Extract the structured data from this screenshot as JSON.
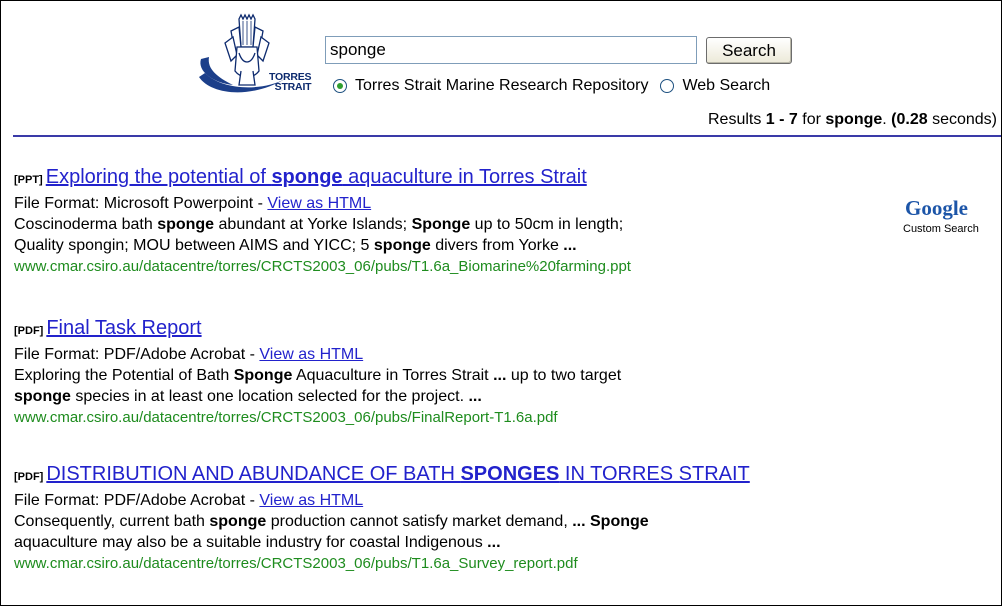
{
  "search": {
    "query": "sponge",
    "button_label": "Search",
    "options": [
      {
        "label": "Torres Strait Marine Research Repository",
        "selected": true
      },
      {
        "label": "Web Search",
        "selected": false
      }
    ]
  },
  "logo": {
    "line1": "TORRES",
    "line2": "STRAIT"
  },
  "summary": {
    "prefix": "Results ",
    "range": "1 - 7",
    "for_text": " for ",
    "query": "sponge",
    "dot": ". ",
    "time": "(0.28",
    "seconds": " seconds)"
  },
  "branding": {
    "google": "Google",
    "custom_search": "Custom Search"
  },
  "results": [
    {
      "tag": "[PPT]",
      "title_parts": [
        "Exploring the potential of ",
        "sponge",
        " aquaculture in Torres Strait"
      ],
      "format_label": "File Format: Microsoft Powerpoint - ",
      "view_html": "View as HTML",
      "snippet1": [
        "Coscinoderma bath ",
        "sponge",
        " abundant at Yorke Islands; ",
        "Sponge",
        " up to 50cm in length;"
      ],
      "snippet2": [
        "Quality spongin; MOU between AIMS and YICC; 5 ",
        "sponge",
        " divers from Yorke ",
        "..."
      ],
      "url": "www.cmar.csiro.au/datacentre/torres/CRCTS2003_06/pubs/T1.6a_Biomarine%20farming.ppt"
    },
    {
      "tag": "[PDF]",
      "title": "Final Task Report",
      "format_label": "File Format: PDF/Adobe Acrobat - ",
      "view_html": "View as HTML",
      "snippet1": [
        "Exploring the Potential of Bath ",
        "Sponge",
        " Aquaculture in Torres Strait ",
        "...",
        " up to two target"
      ],
      "snippet2": [
        "sponge",
        " species in at least one location selected for the project. ",
        "..."
      ],
      "url": "www.cmar.csiro.au/datacentre/torres/CRCTS2003_06/pubs/FinalReport-T1.6a.pdf"
    },
    {
      "tag": "[PDF]",
      "title_parts": [
        "DISTRIBUTION AND ABUNDANCE OF BATH ",
        "SPONGES",
        " IN TORRES STRAIT"
      ],
      "format_label": "File Format: PDF/Adobe Acrobat - ",
      "view_html": "View as HTML",
      "snippet1": [
        "Consequently, current bath ",
        "sponge",
        " production cannot satisfy market demand, ",
        "...",
        " ",
        "Sponge"
      ],
      "snippet2": [
        "aquaculture may also be a suitable industry for coastal Indigenous ",
        "..."
      ],
      "url": "www.cmar.csiro.au/datacentre/torres/CRCTS2003_06/pubs/T1.6a_Survey_report.pdf"
    }
  ],
  "colors": {
    "link": "#2222cc",
    "url": "#1e8c1e",
    "divider": "#3a3aa8",
    "logo": "#0d2a6e"
  }
}
